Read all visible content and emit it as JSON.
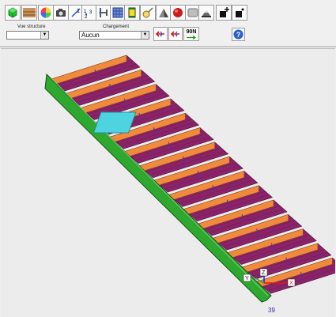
{
  "toolbar": {
    "icons": [
      "green-cube-icon",
      "texture-icon",
      "color-wheel-icon",
      "camera-icon",
      "numbered-nodes-icon",
      "numbering-icon",
      "connections-icon",
      "mesh-grid-icon",
      "yellow-beam-icon",
      "lighting-icon",
      "render-icon",
      "red-sphere-icon",
      "gray-square-icon",
      "robot-icon",
      "node-plus-icon",
      "node-icon"
    ],
    "vue_structure_label": "Vue structure",
    "vue_structure_value": "",
    "chargement_label": "Chargement",
    "chargement_value": "Aucun",
    "load_button_label": "90N",
    "help_label": "?"
  },
  "viewport": {
    "axis_x": "X",
    "axis_y": "Y",
    "axis_z": "Z",
    "node_number": "39"
  },
  "colors": {
    "stringer": "#2ea82e",
    "tread_top": "#8b2368",
    "tread_edge": "#f08a3c",
    "selected": "#4dd4e0",
    "lines": "#5a2ea0"
  }
}
